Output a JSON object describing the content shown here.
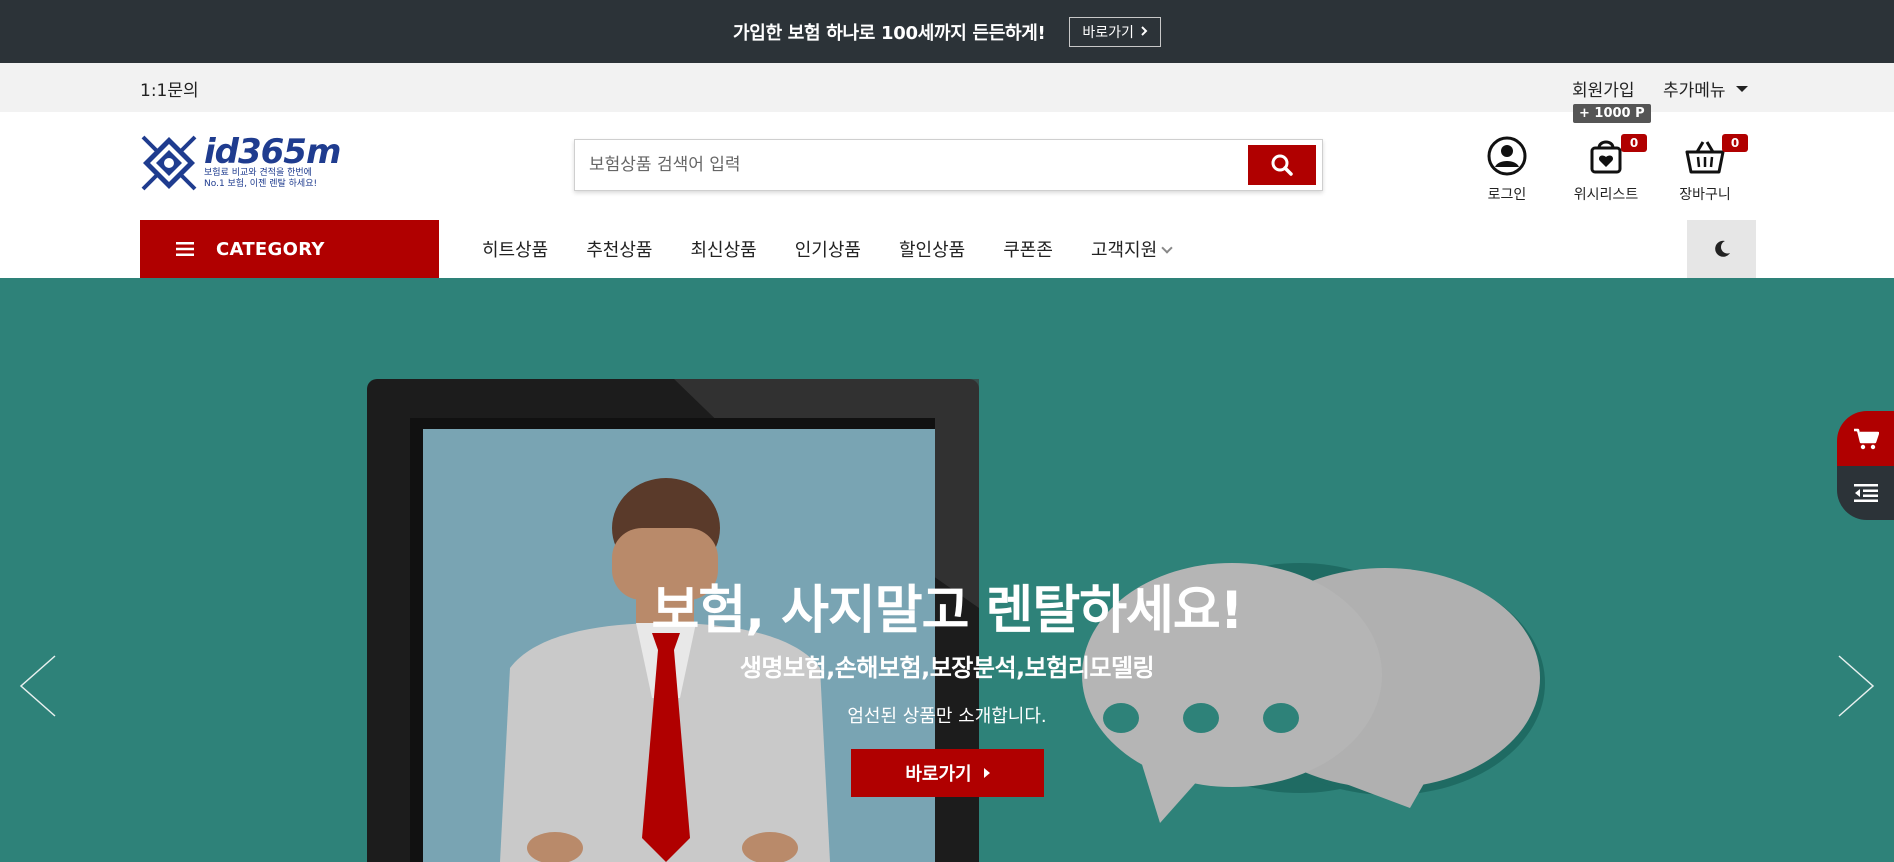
{
  "top_banner": {
    "text": "가입한 보험 하나로 100세까지 든든하게!",
    "button_label": "바로가기"
  },
  "utility_bar": {
    "inquiry": "1:1문의",
    "signup": "회원가입",
    "points_badge": "+ 1000 P",
    "more_menu": "추가메뉴"
  },
  "logo": {
    "wordmark": "id365m",
    "tagline_1": "보험료 비교와 견적을 한번에",
    "tagline_2": "No.1 보험, 이젠 렌탈 하세요!"
  },
  "search": {
    "placeholder": "보험상품 검색어 입력",
    "value": ""
  },
  "header_icons": {
    "login": {
      "label": "로그인",
      "icon": "user-circle-icon"
    },
    "wishlist": {
      "label": "위시리스트",
      "count": "0",
      "icon": "wishlist-bag-icon"
    },
    "cart": {
      "label": "장바구니",
      "count": "0",
      "icon": "basket-icon"
    }
  },
  "nav": {
    "category_label": "CATEGORY",
    "items": [
      {
        "label": "히트상품"
      },
      {
        "label": "추천상품"
      },
      {
        "label": "최신상품"
      },
      {
        "label": "인기상품"
      },
      {
        "label": "할인상품"
      },
      {
        "label": "쿠폰존"
      },
      {
        "label": "고객지원"
      }
    ]
  },
  "hero": {
    "title": "보험, 사지말고 렌탈하세요!",
    "subtitle": "생명보험,손해보험,보장분석,보험리모델링",
    "description": "엄선된 상품만 소개합니다.",
    "button_label": "바로가기"
  },
  "colors": {
    "accent": "#b00000",
    "dark": "#2c3338",
    "hero_bg": "#2e8279",
    "util_bg": "#f2f2f2",
    "brand_blue": "#1f3c8f"
  }
}
